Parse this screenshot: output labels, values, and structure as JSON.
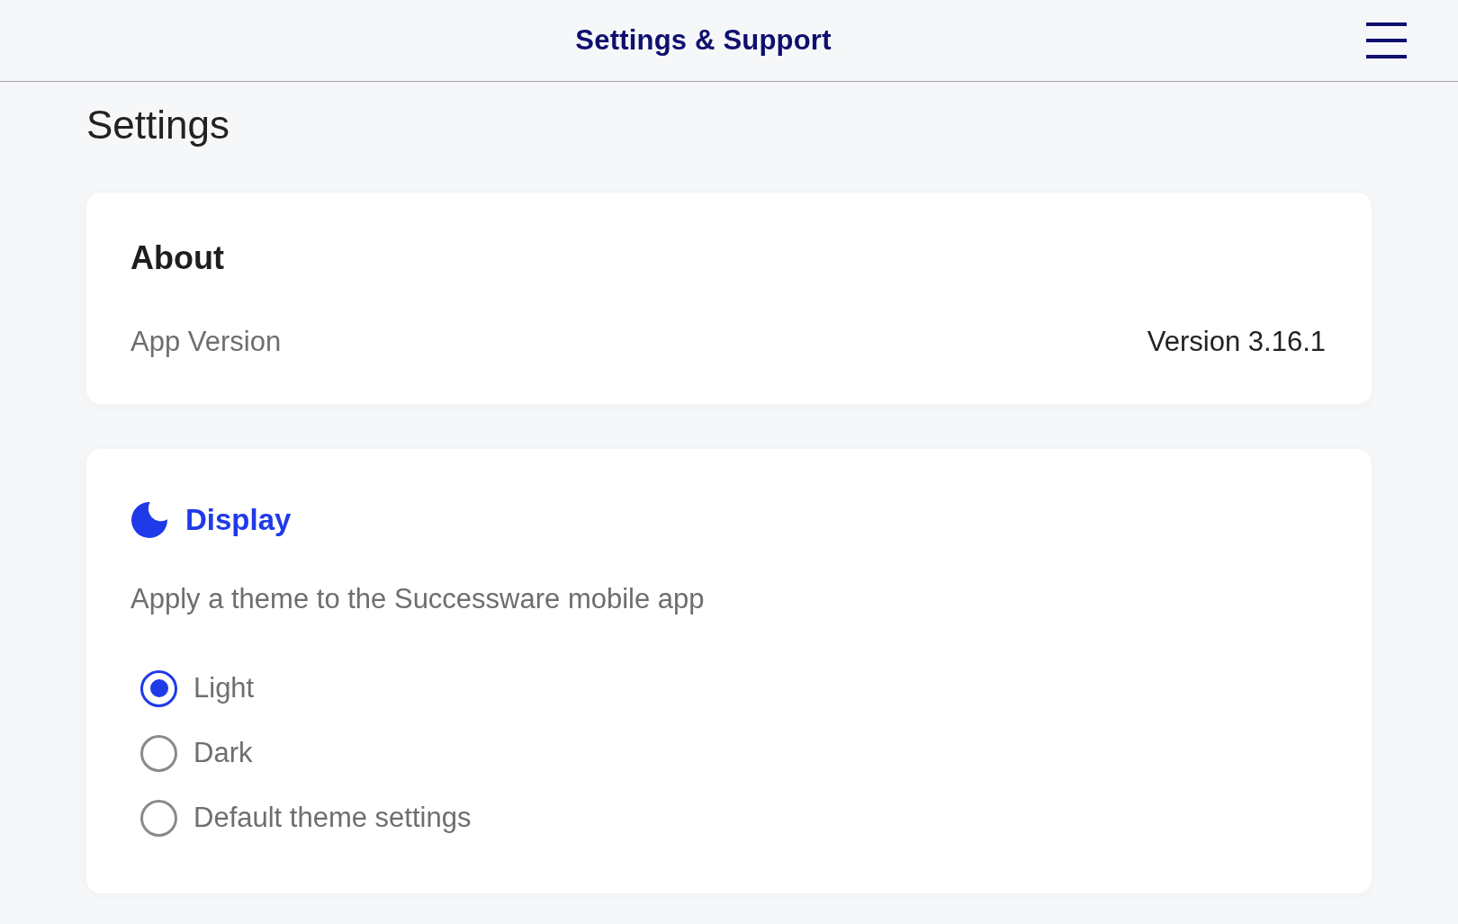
{
  "header": {
    "title": "Settings & Support"
  },
  "page_title": "Settings",
  "about": {
    "title": "About",
    "rows": [
      {
        "label": "App Version",
        "value": "Version 3.16.1"
      }
    ]
  },
  "display": {
    "title": "Display",
    "description": "Apply a theme to the Successware mobile app",
    "options": [
      {
        "label": "Light",
        "selected": true
      },
      {
        "label": "Dark",
        "selected": false
      },
      {
        "label": "Default theme settings",
        "selected": false
      }
    ]
  }
}
